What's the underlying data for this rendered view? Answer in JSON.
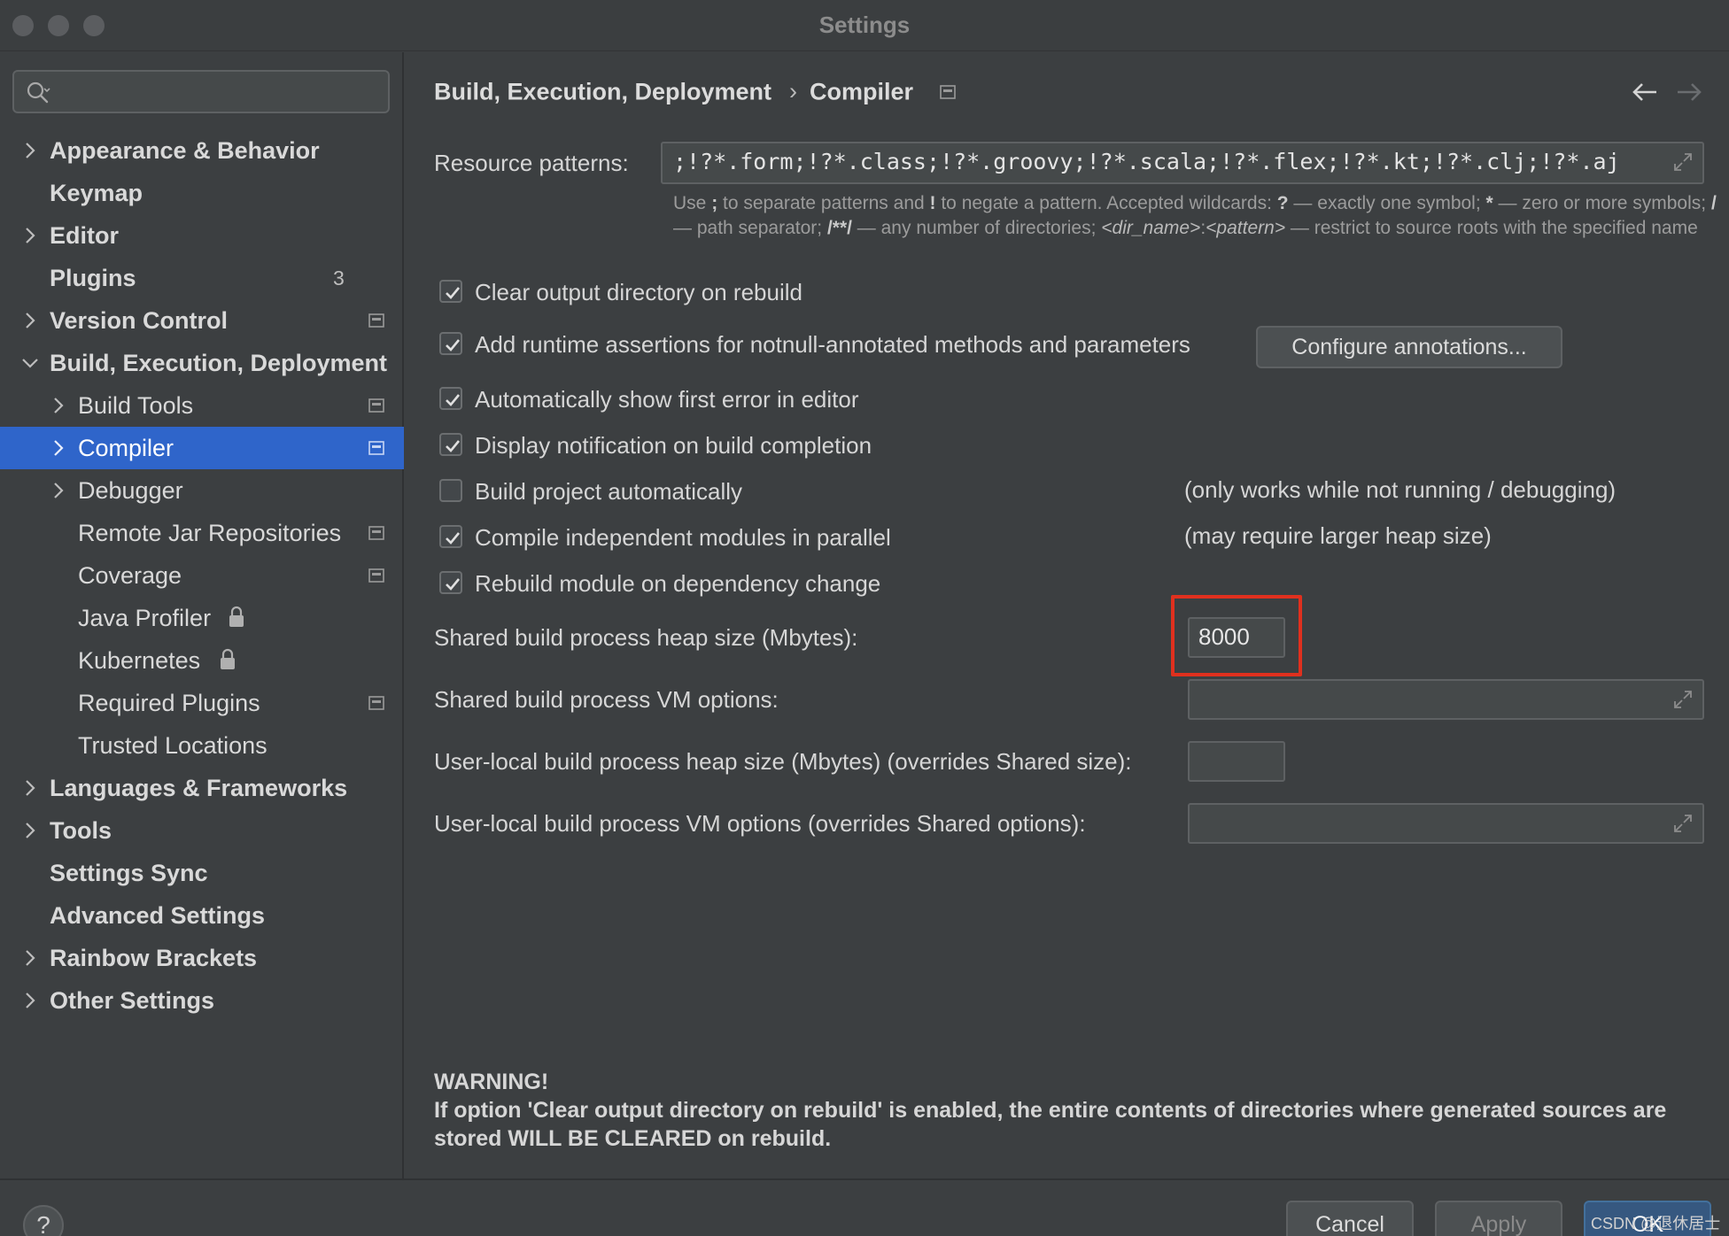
{
  "window": {
    "title": "Settings"
  },
  "search": {
    "placeholder": "",
    "icon": "search-icon"
  },
  "sidebar": {
    "items": [
      {
        "label": "Appearance & Behavior"
      },
      {
        "label": "Keymap"
      },
      {
        "label": "Editor"
      },
      {
        "label": "Plugins",
        "badge": "3"
      },
      {
        "label": "Version Control"
      },
      {
        "label": "Build, Execution, Deployment"
      },
      {
        "label": "Build Tools"
      },
      {
        "label": "Compiler"
      },
      {
        "label": "Debugger"
      },
      {
        "label": "Remote Jar Repositories"
      },
      {
        "label": "Coverage"
      },
      {
        "label": "Java Profiler"
      },
      {
        "label": "Kubernetes"
      },
      {
        "label": "Required Plugins"
      },
      {
        "label": "Trusted Locations"
      },
      {
        "label": "Languages & Frameworks"
      },
      {
        "label": "Tools"
      },
      {
        "label": "Settings Sync"
      },
      {
        "label": "Advanced Settings"
      },
      {
        "label": "Rainbow Brackets"
      },
      {
        "label": "Other Settings"
      }
    ],
    "selected": "Compiler"
  },
  "breadcrumb": {
    "parent": "Build, Execution, Deployment",
    "separator": "›",
    "current": "Compiler"
  },
  "resource": {
    "label": "Resource patterns:",
    "value": ";!?*.form;!?*.class;!?*.groovy;!?*.scala;!?*.flex;!?*.kt;!?*.clj;!?*.aj",
    "hint": {
      "p1": "Use ",
      "semi": ";",
      "p2": " to separate patterns and ",
      "bang": "!",
      "p3": " to negate a pattern. Accepted wildcards: ",
      "q": "?",
      "p4": " — exactly one symbol; ",
      "star": "*",
      "p5": " — zero or more symbols; ",
      "slash": "/",
      "p6": " — path separator; ",
      "dstar": "/**/",
      "p7": " — any number of directories; ",
      "dir": "<dir_name>",
      "colon": ":",
      "pat": "<pattern>",
      "p8": " — restrict to source roots with the specified name"
    }
  },
  "options": {
    "clear_output": {
      "label": "Clear output directory on rebuild",
      "checked": true
    },
    "runtime_assertions": {
      "label": "Add runtime assertions for notnull-annotated methods and parameters",
      "checked": true
    },
    "configure_annotations": "Configure annotations...",
    "show_first_error": {
      "label": "Automatically show first error in editor",
      "checked": true
    },
    "notify_completion": {
      "label": "Display notification on build completion",
      "checked": true
    },
    "build_auto": {
      "label": "Build project automatically",
      "checked": false,
      "note": "(only works while not running / debugging)"
    },
    "parallel": {
      "label": "Compile independent modules in parallel",
      "checked": true,
      "note": "(may require larger heap size)"
    },
    "rebuild_dep": {
      "label": "Rebuild module on dependency change",
      "checked": true
    }
  },
  "heap": {
    "shared_label": "Shared build process heap size (Mbytes):",
    "shared_value": "8000",
    "shared_vm_label": "Shared build process VM options:",
    "shared_vm_value": "",
    "local_label": "User-local build process heap size (Mbytes) (overrides Shared size):",
    "local_value": "",
    "local_vm_label": "User-local build process VM options (overrides Shared options):",
    "local_vm_value": ""
  },
  "warning": {
    "title": "WARNING!",
    "text": "If option 'Clear output directory on rebuild' is enabled, the entire contents of directories where generated sources are stored WILL BE CLEARED on rebuild."
  },
  "footer": {
    "help": "?",
    "cancel": "Cancel",
    "apply": "Apply",
    "ok": "OK",
    "watermark": "CSDN @退休居士"
  },
  "colors": {
    "accent": "#2f65ca",
    "highlight": "#e0301e",
    "background": "#3c3f41"
  }
}
